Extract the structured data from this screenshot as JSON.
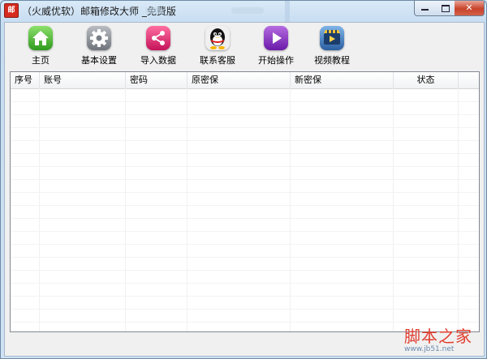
{
  "window": {
    "title": "（火威优软）邮箱修改大师 _免费版",
    "app_icon_text": "邮",
    "controls": {
      "minimize": "",
      "maximize": "",
      "close": "✕"
    }
  },
  "toolbar": {
    "items": [
      {
        "label": "主页",
        "icon": "home-icon"
      },
      {
        "label": "基本设置",
        "icon": "gear-icon"
      },
      {
        "label": "导入数据",
        "icon": "share-icon"
      },
      {
        "label": "联系客服",
        "icon": "qq-penguin-icon"
      },
      {
        "label": "开始操作",
        "icon": "play-icon"
      },
      {
        "label": "视频教程",
        "icon": "video-icon"
      }
    ]
  },
  "table": {
    "columns": [
      "序号",
      "账号",
      "密码",
      "原密保",
      "新密保",
      "状态"
    ],
    "rows": []
  },
  "watermark": {
    "text": "脚本之家",
    "url": "www.jb51.net"
  }
}
